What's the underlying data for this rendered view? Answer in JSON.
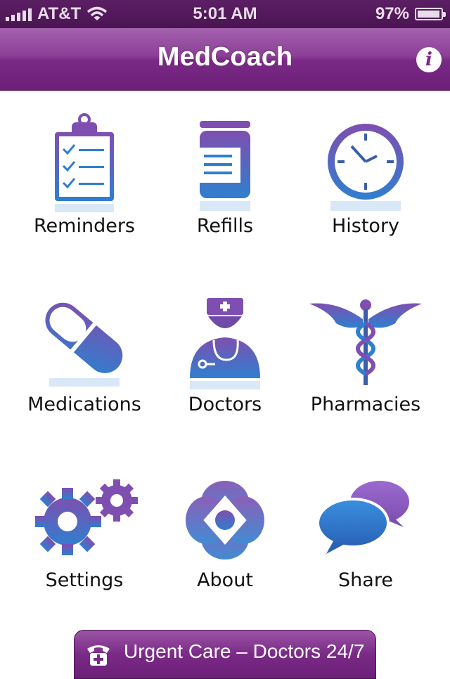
{
  "status": {
    "carrier": "AT&T",
    "time": "5:01 AM",
    "battery": "97%",
    "battery_level": 0.97,
    "wifi_icon": "wifi-icon",
    "signal_icon": "signal-bars-icon"
  },
  "nav": {
    "title": "MedCoach",
    "info_icon": "info-icon",
    "info_glyph": "i"
  },
  "tiles": [
    {
      "label": "Reminders",
      "icon": "clipboard-checklist-icon"
    },
    {
      "label": "Refills",
      "icon": "pill-bottle-icon"
    },
    {
      "label": "History",
      "icon": "clock-icon"
    },
    {
      "label": "Medications",
      "icon": "capsule-icon"
    },
    {
      "label": "Doctors",
      "icon": "doctor-icon"
    },
    {
      "label": "Pharmacies",
      "icon": "caduceus-icon"
    },
    {
      "label": "Settings",
      "icon": "gears-icon"
    },
    {
      "label": "About",
      "icon": "flower-logo-icon"
    },
    {
      "label": "Share",
      "icon": "speech-bubbles-icon"
    }
  ],
  "urgent": {
    "label": "Urgent Care – Doctors 24/7",
    "icon": "phone-cross-icon"
  },
  "colors": {
    "brand_purple": "#7a2a86",
    "icon_blue": "#2f7fcf",
    "icon_purple": "#7e4fb0"
  }
}
